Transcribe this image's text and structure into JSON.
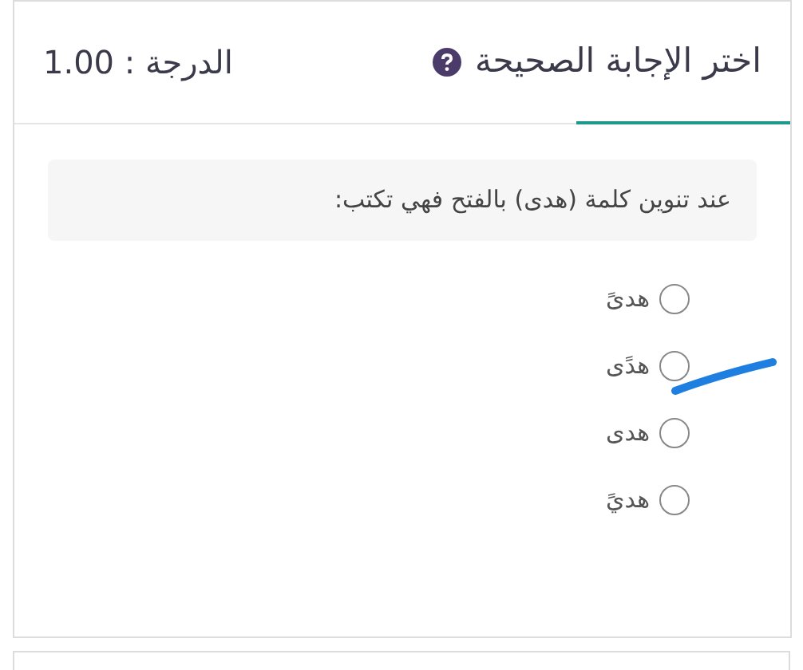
{
  "header": {
    "title": "اختر الإجابة الصحيحة",
    "grade": "الدرجة : 1.00"
  },
  "question": {
    "text": "عند تنوين كلمة (هدى) بالفتح فهي تكتب:"
  },
  "options": [
    {
      "label": "هدىً",
      "selected": false,
      "pen_mark": false
    },
    {
      "label": "هدًى",
      "selected": false,
      "pen_mark": true
    },
    {
      "label": "هدى",
      "selected": false,
      "pen_mark": false
    },
    {
      "label": "هديً",
      "selected": false,
      "pen_mark": false
    }
  ]
}
